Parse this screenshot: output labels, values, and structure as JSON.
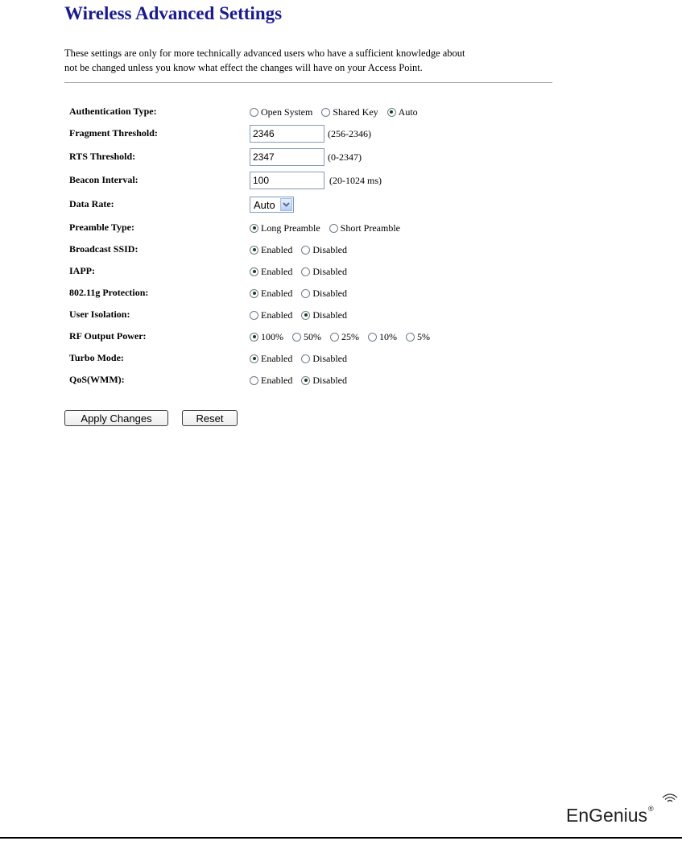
{
  "page": {
    "title": "Wireless Advanced Settings",
    "intro_line1": "These settings are only for more technically advanced users who have a sufficient knowledge about",
    "intro_line2": "not be changed unless you know what effect the changes will have on your Access Point."
  },
  "form": {
    "auth_type": {
      "label": "Authentication Type:",
      "options": [
        "Open System",
        "Shared Key",
        "Auto"
      ],
      "selected": "Auto"
    },
    "fragment_threshold": {
      "label": "Fragment Threshold:",
      "value": "2346",
      "range": "(256-2346)"
    },
    "rts_threshold": {
      "label": "RTS Threshold:",
      "value": "2347",
      "range": "(0-2347)"
    },
    "beacon_interval": {
      "label": "Beacon Interval:",
      "value": "100",
      "range": "(20-1024 ms)"
    },
    "data_rate": {
      "label": "Data Rate:",
      "value": "Auto"
    },
    "preamble_type": {
      "label": "Preamble Type:",
      "options": [
        "Long Preamble",
        "Short Preamble"
      ],
      "selected": "Long Preamble"
    },
    "broadcast_ssid": {
      "label": "Broadcast SSID:",
      "options": [
        "Enabled",
        "Disabled"
      ],
      "selected": "Enabled"
    },
    "iapp": {
      "label": "IAPP:",
      "options": [
        "Enabled",
        "Disabled"
      ],
      "selected": "Enabled"
    },
    "protection_80211g": {
      "label": "802.11g Protection:",
      "options": [
        "Enabled",
        "Disabled"
      ],
      "selected": "Enabled"
    },
    "user_isolation": {
      "label": "User Isolation:",
      "options": [
        "Enabled",
        "Disabled"
      ],
      "selected": "Disabled"
    },
    "rf_output_power": {
      "label": "RF Output Power:",
      "options": [
        "100%",
        "50%",
        "25%",
        "10%",
        "5%"
      ],
      "selected": "100%"
    },
    "turbo_mode": {
      "label": "Turbo Mode:",
      "options": [
        "Enabled",
        "Disabled"
      ],
      "selected": "Enabled"
    },
    "qos_wmm": {
      "label": "QoS(WMM):",
      "options": [
        "Enabled",
        "Disabled"
      ],
      "selected": "Disabled"
    }
  },
  "buttons": {
    "apply": "Apply Changes",
    "reset": "Reset"
  },
  "brand": {
    "name": "EnGenius",
    "registered_mark": "®"
  },
  "colors": {
    "title": "#1a1a8f",
    "radio_dot": "#1a3e1a",
    "input_border": "#7f9db9"
  },
  "icons": {
    "select_arrow": "chevron-down-icon",
    "logo_signal": "wifi-signal-icon"
  }
}
